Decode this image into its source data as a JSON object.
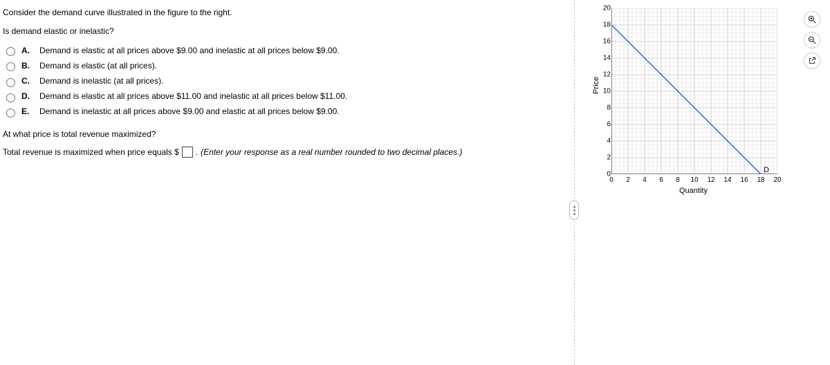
{
  "question": {
    "line1": "Consider the demand curve illustrated in the figure to the right.",
    "line2": "Is demand elastic or inelastic?"
  },
  "choices": [
    {
      "letter": "A.",
      "text": "Demand is elastic at all prices above $9.00 and inelastic at all prices below $9.00."
    },
    {
      "letter": "B.",
      "text": "Demand is elastic (at all prices)."
    },
    {
      "letter": "C.",
      "text": "Demand is inelastic (at all prices)."
    },
    {
      "letter": "D.",
      "text": "Demand is elastic at all prices above $11.00 and inelastic at all prices below $11.00."
    },
    {
      "letter": "E.",
      "text": "Demand is inelastic at all prices above $9.00 and elastic at all prices below $9.00."
    }
  ],
  "part2": {
    "prompt": "At what price is total revenue maximized?",
    "line_pre": "Total revenue is maximized when price equals $",
    "line_post": ". ",
    "hint": "(Enter your response as a real number rounded to two decimal places.)"
  },
  "axis": {
    "ylabel": "Price",
    "xlabel": "Quantity",
    "series_label": "D"
  },
  "chart_data": {
    "type": "line",
    "title": "",
    "xlabel": "Quantity",
    "ylabel": "Price",
    "xlim": [
      0,
      20
    ],
    "ylim": [
      0,
      20
    ],
    "x_ticks": [
      0,
      2,
      4,
      6,
      8,
      10,
      12,
      14,
      16,
      18,
      20
    ],
    "y_ticks": [
      0,
      2,
      4,
      6,
      8,
      10,
      12,
      14,
      16,
      18,
      20
    ],
    "series": [
      {
        "name": "D",
        "x": [
          0,
          18
        ],
        "y": [
          18,
          0
        ]
      }
    ]
  }
}
